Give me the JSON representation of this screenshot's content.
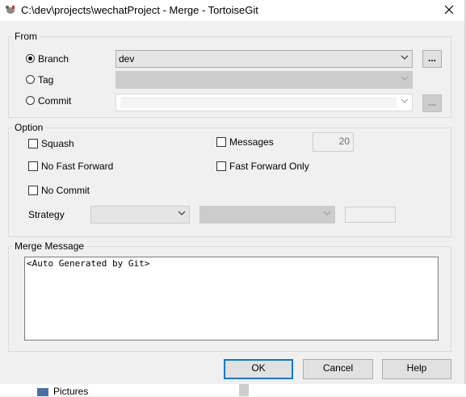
{
  "window": {
    "title": "C:\\dev\\projects\\wechatProject - Merge - TortoiseGit"
  },
  "from": {
    "label": "From",
    "branch_label": "Branch",
    "tag_label": "Tag",
    "commit_label": "Commit",
    "branch_value": "dev",
    "browse_label": "...",
    "commit_browse_label": "..."
  },
  "option": {
    "label": "Option",
    "squash": "Squash",
    "no_fast_forward": "No Fast Forward",
    "no_commit": "No Commit",
    "messages": "Messages",
    "messages_count": "20",
    "fast_forward_only": "Fast Forward Only",
    "strategy": "Strategy"
  },
  "merge_message": {
    "label": "Merge Message",
    "text": "<Auto Generated by Git>"
  },
  "buttons": {
    "ok": "OK",
    "cancel": "Cancel",
    "help": "Help"
  },
  "background": {
    "item": "Pictures"
  }
}
